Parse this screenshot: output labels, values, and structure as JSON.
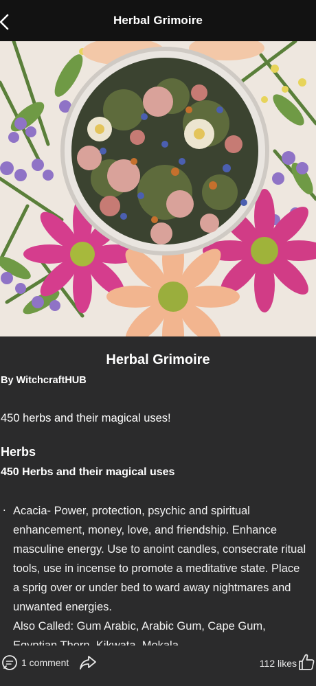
{
  "header": {
    "title": "Herbal Grimoire"
  },
  "post": {
    "title": "Herbal Grimoire",
    "author": "By WitchcraftHUB",
    "intro": "450 herbs and their magical uses!",
    "section_title": "Herbs",
    "subtitle": "450 Herbs and their magical uses",
    "bullet": ".",
    "entry_main": "Acacia- Power, protection, psychic and spiritual enhancement, money, love, and friendship. Enhance masculine energy. Use to anoint candles, consecrate ritual tools, use in incense to promote a meditative state. Place a sprig over or under bed to ward away nightmares and unwanted energies.",
    "entry_aliases": "Also Called: Gum Arabic, Arabic Gum, Cape Gum, Egyptian Thorn, Kikwata, Mokala"
  },
  "footer": {
    "comments": "1 comment",
    "likes": "112 likes"
  },
  "colors": {
    "background": "#2b2b2c",
    "topbar": "#121212"
  }
}
